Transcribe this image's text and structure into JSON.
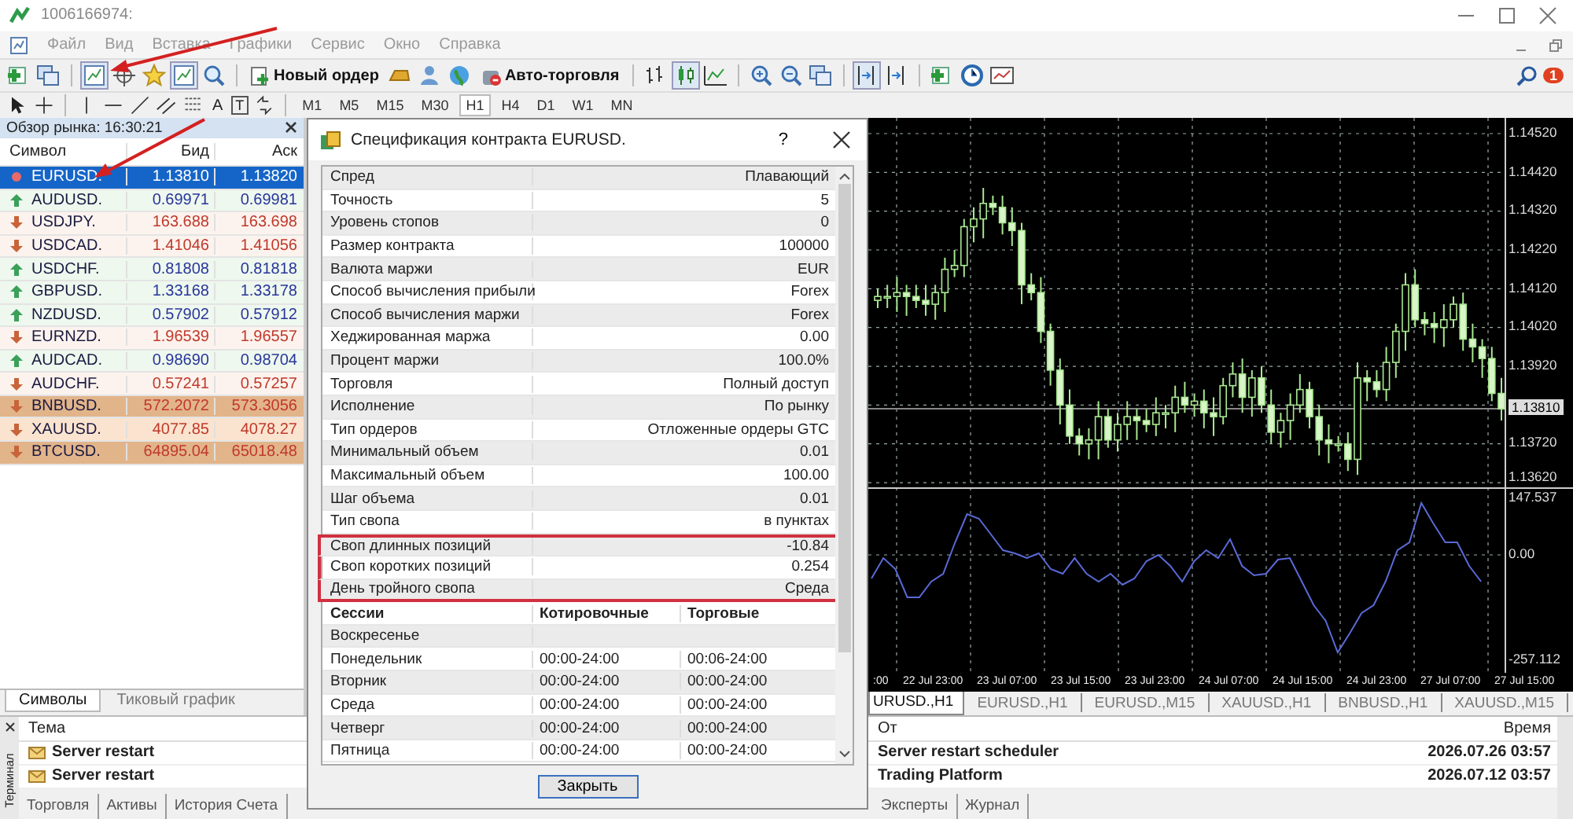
{
  "window": {
    "title": "1006166974:"
  },
  "menu": [
    "Файл",
    "Вид",
    "Вставка",
    "Графики",
    "Сервис",
    "Окно",
    "Справка"
  ],
  "toolbar": {
    "new_order": "Новый ордер",
    "auto_trading": "Авто-торговля",
    "notifications": "1",
    "text_tool": "A",
    "label_tool": "T"
  },
  "timeframes": [
    {
      "label": "M1",
      "selected": false
    },
    {
      "label": "M5",
      "selected": false
    },
    {
      "label": "M15",
      "selected": false
    },
    {
      "label": "M30",
      "selected": false
    },
    {
      "label": "H1",
      "selected": true
    },
    {
      "label": "H4",
      "selected": false
    },
    {
      "label": "D1",
      "selected": false
    },
    {
      "label": "W1",
      "selected": false
    },
    {
      "label": "MN",
      "selected": false
    }
  ],
  "market_watch": {
    "title": "Обзор рынка: 16:30:21",
    "columns": [
      "Символ",
      "Бид",
      "Аск"
    ],
    "rows": [
      {
        "symbol": "EURUSD.",
        "bid": "1.13810",
        "ask": "1.13820",
        "kind": "flat",
        "selected": true
      },
      {
        "symbol": "AUDUSD.",
        "bid": "0.69971",
        "ask": "0.69981",
        "kind": "up",
        "color": "#eef8ee",
        "selected": false
      },
      {
        "symbol": "USDJPY.",
        "bid": "163.688",
        "ask": "163.698",
        "kind": "down",
        "color": "#fdf3ee",
        "selected": false
      },
      {
        "symbol": "USDCAD.",
        "bid": "1.41046",
        "ask": "1.41056",
        "kind": "down",
        "color": "#fdf3ee",
        "selected": false
      },
      {
        "symbol": "USDCHF.",
        "bid": "0.81808",
        "ask": "0.81818",
        "kind": "up",
        "color": "#eef8ee",
        "selected": false
      },
      {
        "symbol": "GBPUSD.",
        "bid": "1.33168",
        "ask": "1.33178",
        "kind": "up",
        "color": "#eef8ee",
        "selected": false
      },
      {
        "symbol": "NZDUSD.",
        "bid": "0.57902",
        "ask": "0.57912",
        "kind": "up",
        "color": "#eef8ee",
        "selected": false
      },
      {
        "symbol": "EURNZD.",
        "bid": "1.96539",
        "ask": "1.96557",
        "kind": "down",
        "color": "#fdf3ee",
        "selected": false
      },
      {
        "symbol": "AUDCAD.",
        "bid": "0.98690",
        "ask": "0.98704",
        "kind": "up",
        "color": "#eef8ee",
        "selected": false
      },
      {
        "symbol": "AUDCHF.",
        "bid": "0.57241",
        "ask": "0.57257",
        "kind": "down",
        "color": "#fdf3ee",
        "selected": false
      },
      {
        "symbol": "BNBUSD.",
        "bid": "572.2072",
        "ask": "573.3056",
        "kind": "down",
        "color": "#e2b48a",
        "selected": false
      },
      {
        "symbol": "XAUUSD.",
        "bid": "4077.85",
        "ask": "4078.27",
        "kind": "down",
        "color": "#fbe4cf",
        "selected": false
      },
      {
        "symbol": "BTCUSD.",
        "bid": "64895.04",
        "ask": "65018.48",
        "kind": "down",
        "color": "#e2b48a",
        "selected": false
      }
    ],
    "tabs": [
      {
        "label": "Символы",
        "selected": true
      },
      {
        "label": "Тиковый график",
        "selected": false
      }
    ]
  },
  "dialog": {
    "title": "Спецификация контракта EURUSD.",
    "help": "?",
    "properties": [
      {
        "name": "Спред",
        "value": "Плавающий",
        "highlighted": false
      },
      {
        "name": "Точность",
        "value": "5",
        "highlighted": false
      },
      {
        "name": "Уровень стопов",
        "value": "0",
        "highlighted": false
      },
      {
        "name": "Размер контракта",
        "value": "100000",
        "highlighted": false
      },
      {
        "name": "Валюта маржи",
        "value": "EUR",
        "highlighted": false
      },
      {
        "name": "Способ вычисления прибыли",
        "value": "Forex",
        "highlighted": false
      },
      {
        "name": "Способ вычисления маржи",
        "value": "Forex",
        "highlighted": false
      },
      {
        "name": "Хеджированная маржа",
        "value": "0.00",
        "highlighted": false
      },
      {
        "name": "Процент маржи",
        "value": "100.0%",
        "highlighted": false
      },
      {
        "name": "Торговля",
        "value": "Полный доступ",
        "highlighted": false
      },
      {
        "name": "Исполнение",
        "value": "По рынку",
        "highlighted": false
      },
      {
        "name": "Тип ордеров",
        "value": "Отложенные ордеры GTC",
        "highlighted": false
      },
      {
        "name": "Минимальный объем",
        "value": "0.01",
        "highlighted": false
      },
      {
        "name": "Максимальный объем",
        "value": "100.00",
        "highlighted": false
      },
      {
        "name": "Шаг объема",
        "value": "0.01",
        "highlighted": false
      },
      {
        "name": "Тип свопа",
        "value": "в пунктах",
        "highlighted": false
      },
      {
        "name": "Своп длинных позиций",
        "value": "-10.84",
        "highlighted": true
      },
      {
        "name": "Своп коротких позиций",
        "value": "0.254",
        "highlighted": true
      },
      {
        "name": "День тройного свопа",
        "value": "Среда",
        "highlighted": true
      }
    ],
    "sessions_header": [
      "Сессии",
      "Котировочные",
      "Торговые"
    ],
    "sessions": [
      {
        "day": "Воскресенье"
      },
      {
        "day": "Понедельник",
        "quotes": "00:00-24:00",
        "trades": "00:06-24:00"
      },
      {
        "day": "Вторник",
        "quotes": "00:00-24:00",
        "trades": "00:00-24:00"
      },
      {
        "day": "Среда",
        "quotes": "00:00-24:00",
        "trades": "00:00-24:00"
      },
      {
        "day": "Четверг",
        "quotes": "00:00-24:00",
        "trades": "00:00-24:00"
      },
      {
        "day": "Пятница",
        "quotes": "00:00-24:00",
        "trades": "00:00-24:00"
      }
    ],
    "close_button": "Закрыть"
  },
  "chart": {
    "price_labels": [
      {
        "text": "1.14520",
        "current": false
      },
      {
        "text": "1.14420",
        "current": false
      },
      {
        "text": "1.14320",
        "current": false
      },
      {
        "text": "1.14220",
        "current": false
      },
      {
        "text": "1.14120",
        "current": false
      },
      {
        "text": "1.14020",
        "current": false
      },
      {
        "text": "1.13920",
        "current": false
      },
      {
        "text": "1.13810",
        "current": true
      },
      {
        "text": "1.13720",
        "current": false
      },
      {
        "text": "1.13620",
        "current": false
      }
    ],
    "indicator_labels": [
      "147.537",
      "0.00",
      "-257.112"
    ],
    "time_labels": [
      ":00",
      "22 Jul 23:00",
      "23 Jul 07:00",
      "23 Jul 15:00",
      "23 Jul 23:00",
      "24 Jul 07:00",
      "24 Jul 15:00",
      "24 Jul 23:00",
      "27 Jul 07:00",
      "27 Jul 15:00"
    ],
    "tabs": [
      {
        "label": "URUSD.,H1",
        "selected": true
      },
      {
        "label": "EURUSD.,H1",
        "selected": false
      },
      {
        "label": "EURUSD.,M15",
        "selected": false
      },
      {
        "label": "XAUUSD.,H1",
        "selected": false
      },
      {
        "label": "BNBUSD.,H1",
        "selected": false
      },
      {
        "label": "XAUUSD.,M15",
        "selected": false
      }
    ]
  },
  "terminal": {
    "side_label": "Терминал",
    "columns": [
      "Тема",
      "От",
      "Время"
    ],
    "messages": [
      {
        "subject": "Server restart",
        "from": "Server restart scheduler",
        "time": "2026.07.26 03:57",
        "unread": true
      },
      {
        "subject": "Server restart",
        "from": "Trading Platform",
        "time": "2026.07.12 03:57",
        "unread": true
      }
    ],
    "tabs_left": [
      "Торговля",
      "Активы",
      "История Счета"
    ],
    "tabs_right": [
      "Эксперты",
      "Журнал"
    ]
  }
}
